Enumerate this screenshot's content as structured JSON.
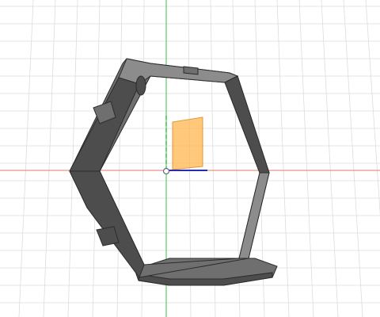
{
  "viewport": {
    "background_color": "#ffffff",
    "grid_color": "#d9dde2",
    "x_axis_color": "#e07a6a",
    "y_axis_color": "#3cc04a",
    "z_axis_color": "#2a2ab8",
    "origin_icon": "origin-point-icon"
  },
  "model": {
    "shape": "hexagonal-frame-on-base",
    "body_color": "#6f6f6f",
    "body_dark_color": "#4d4d4d",
    "body_light_color": "#8c8c8c",
    "outline_color": "#2c2c2c"
  },
  "sketch_plane": {
    "fill_color": "#ffb54d",
    "stroke_color": "#e4973a",
    "opacity": 0.75
  }
}
